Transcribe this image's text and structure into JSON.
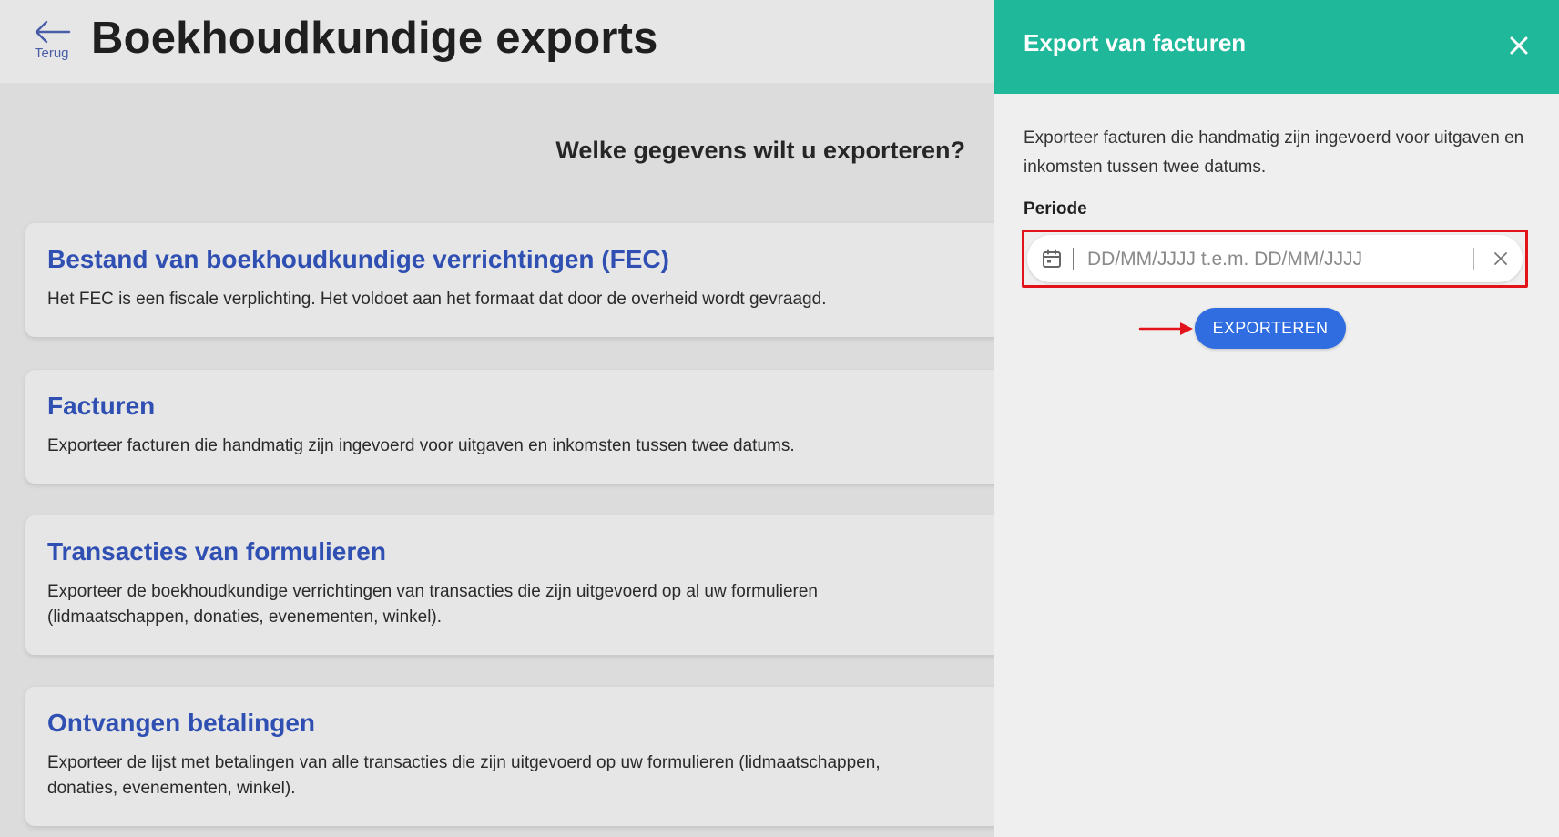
{
  "header": {
    "back_label": "Terug",
    "title": "Boekhoudkundige exports"
  },
  "main": {
    "question": "Welke gegevens wilt u exporteren?",
    "cards": [
      {
        "title": "Bestand van boekhoudkundige verrichtingen (FEC)",
        "description": "Het FEC is een fiscale verplichting. Het voldoet aan het formaat dat door de overheid wordt gevraagd."
      },
      {
        "title": "Facturen",
        "description": "Exporteer facturen die handmatig zijn ingevoerd voor uitgaven en inkomsten tussen twee datums."
      },
      {
        "title": "Transacties van formulieren",
        "description": "Exporteer de boekhoudkundige verrichtingen van transacties die zijn uitgevoerd op al uw formulieren (lidmaatschappen, donaties, evenementen, winkel)."
      },
      {
        "title": "Ontvangen betalingen",
        "description": "Exporteer de lijst met betalingen van alle transacties die zijn uitgevoerd op uw formulieren (lidmaatschappen, donaties, evenementen, winkel)."
      }
    ]
  },
  "drawer": {
    "title": "Export van facturen",
    "description": "Exporteer facturen die handmatig zijn ingevoerd voor uitgaven en inkomsten tussen twee datums.",
    "period_label": "Periode",
    "period_value": "",
    "period_placeholder": "DD/MM/JJJJ t.e.m. DD/MM/JJJJ",
    "export_label": "EXPORTEREN"
  },
  "colors": {
    "drawer_header": "#1fb89a",
    "card_title": "#2f4fb2",
    "primary_button": "#2f6de0",
    "highlight": "#e3131c"
  },
  "icons": {
    "back": "arrow-left-icon",
    "close": "close-icon",
    "calendar": "calendar-icon",
    "clear": "clear-icon",
    "pointer": "arrow-right-icon"
  }
}
